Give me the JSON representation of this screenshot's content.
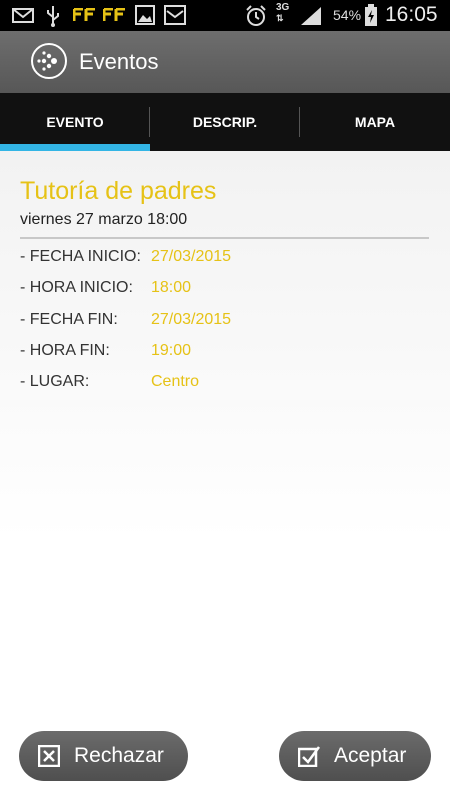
{
  "status_bar": {
    "battery_percent": "54%",
    "time": "16:05",
    "network": "3G",
    "icons": [
      "email-icon",
      "usb-icon",
      "ff-app-icon",
      "ff-app-icon",
      "gallery-icon",
      "mail-icon",
      "alarm-icon",
      "network-3g-icon",
      "signal-icon",
      "battery-charging-icon"
    ]
  },
  "app_bar": {
    "title": "Eventos",
    "logo_icon": "app-logo-icon"
  },
  "tabs": [
    {
      "label": "EVENTO",
      "selected": true
    },
    {
      "label": "DESCRIP.",
      "selected": false
    },
    {
      "label": "MAPA",
      "selected": false
    }
  ],
  "event": {
    "title": "Tutoría de padres",
    "date": "viernes 27 marzo 18:00",
    "details": [
      {
        "label": "- FECHA INICIO:",
        "value": "27/03/2015"
      },
      {
        "label": "- HORA INICIO:",
        "value": "18:00"
      },
      {
        "label": "- FECHA FIN:",
        "value": "27/03/2015"
      },
      {
        "label": "- HORA FIN:",
        "value": "19:00"
      },
      {
        "label": "- LUGAR:",
        "value": "Centro"
      }
    ]
  },
  "actions": {
    "reject_label": "Rechazar",
    "accept_label": "Aceptar"
  },
  "colors": {
    "accent_yellow": "#e6c216",
    "tab_indicator": "#33b5e5"
  }
}
